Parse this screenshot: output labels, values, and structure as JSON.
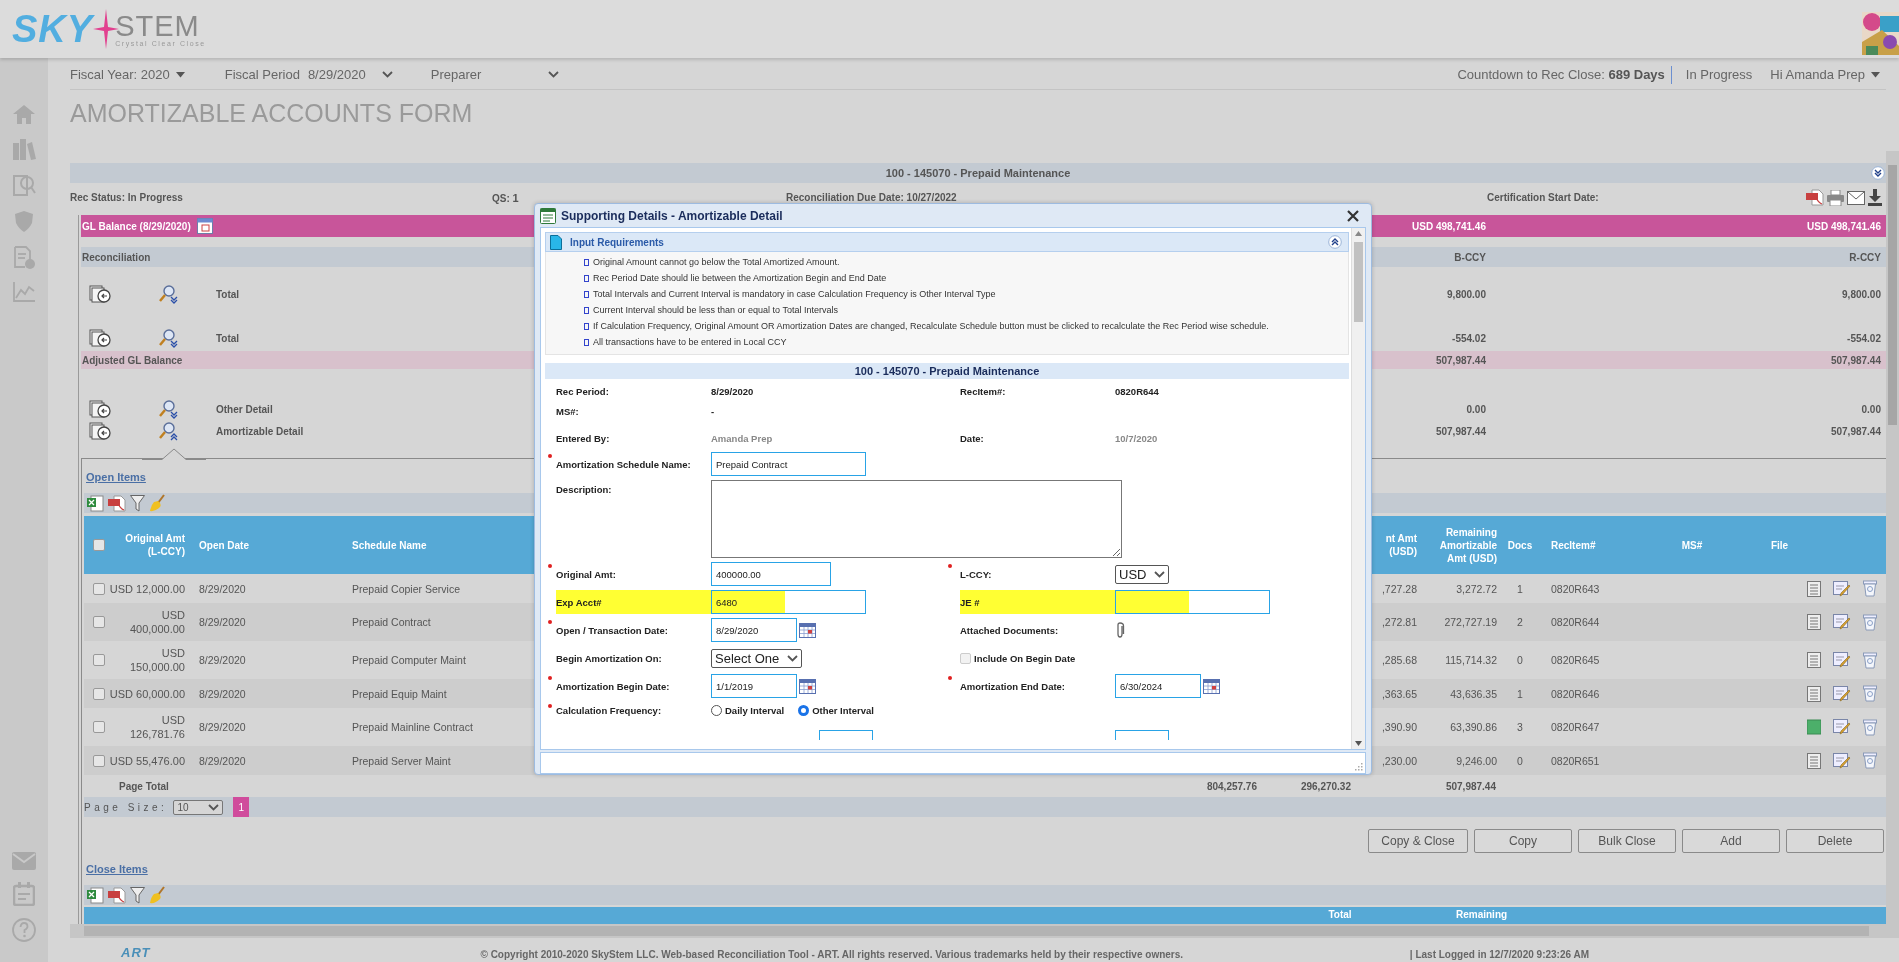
{
  "logo": {
    "brand_first": "SKY",
    "brand_second": "STEM",
    "tagline": "Crystal Clear Close"
  },
  "toolbar": {
    "fiscal_year": "Fiscal Year: 2020",
    "fiscal_period_label": "Fiscal Period",
    "fiscal_period": "8/29/2020",
    "role": "Preparer",
    "countdown": "Countdown to Rec Close: **689 Days**",
    "status": "In Progress",
    "greeting": "Hi Amanda Prep"
  },
  "page_title": "AMORTIZABLE ACCOUNTS FORM",
  "account_band": "100 - 145070 - Prepaid Maintenance",
  "info": {
    "rec_status": "Rec Status: In Progress",
    "qs_label": "QS:",
    "qs_value": "1",
    "due_date": "Reconciliation Due Date: 10/27/2022",
    "certification": "Certification Start Date:"
  },
  "gl_balance": {
    "label": "GL Balance (8/29/2020)",
    "b_ccy": "USD 498,741.46",
    "r_ccy": "USD 498,741.46"
  },
  "reconciliation": {
    "title": "Reconciliation",
    "b_ccy_header": "B-CCY",
    "r_ccy_header": "R-CCY",
    "rows": [
      {
        "kind": "line",
        "label": "Total",
        "b_ccy": "9,800.00",
        "r_ccy": "9,800.00",
        "expanded": false
      },
      {
        "kind": "line",
        "label": "Total",
        "b_ccy": "-554.02",
        "r_ccy": "-554.02",
        "expanded": false
      },
      {
        "kind": "subtotal",
        "label": "Adjusted GL Balance",
        "b_ccy": "507,987.44",
        "r_ccy": "507,987.44"
      },
      {
        "kind": "line",
        "label": "Other Detail",
        "b_ccy": "0.00",
        "r_ccy": "0.00",
        "expanded": false
      },
      {
        "kind": "line",
        "label": "Amortizable Detail",
        "b_ccy": "507,987.44",
        "r_ccy": "507,987.44",
        "expanded": true
      }
    ]
  },
  "open_items": {
    "title": "Open Items",
    "select_all": false,
    "columns": [
      "Original Amt (L-CCY)",
      "Open Date",
      "Schedule Name",
      "nt Amt (USD)",
      "Remaining Amortizable Amt (USD)",
      "Docs",
      "RecItem#",
      "MS#",
      "File"
    ],
    "rows": [
      {
        "selected": false,
        "original_amt": "USD 12,000.00",
        "open_date": "8/29/2020",
        "schedule_name": "Prepaid Copier Service",
        "amt_usd": ",727.28",
        "remaining": "3,272.72",
        "docs": "1",
        "rec_item": "0820R643",
        "attached": false
      },
      {
        "selected": false,
        "original_amt": "USD 400,000.00",
        "open_date": "8/29/2020",
        "schedule_name": "Prepaid Contract",
        "amt_usd": ",272.81",
        "remaining": "272,727.19",
        "docs": "2",
        "rec_item": "0820R644",
        "attached": false
      },
      {
        "selected": false,
        "original_amt": "USD 150,000.00",
        "open_date": "8/29/2020",
        "schedule_name": "Prepaid Computer Maint",
        "amt_usd": ",285.68",
        "remaining": "115,714.32",
        "docs": "0",
        "rec_item": "0820R645",
        "attached": false
      },
      {
        "selected": false,
        "original_amt": "USD 60,000.00",
        "open_date": "8/29/2020",
        "schedule_name": "Prepaid Equip Maint",
        "amt_usd": ",363.65",
        "remaining": "43,636.35",
        "docs": "1",
        "rec_item": "0820R646",
        "attached": false
      },
      {
        "selected": false,
        "original_amt": "USD 126,781.76",
        "open_date": "8/29/2020",
        "schedule_name": "Prepaid Mainline Contract",
        "amt_usd": ",390.90",
        "remaining": "63,390.86",
        "docs": "3",
        "rec_item": "0820R647",
        "attached": true
      },
      {
        "selected": false,
        "original_amt": "USD 55,476.00",
        "open_date": "8/29/2020",
        "schedule_name": "Prepaid Server Maint",
        "amt_usd": ",230.00",
        "remaining": "9,246.00",
        "docs": "0",
        "rec_item": "0820R651",
        "attached": false
      }
    ],
    "page_total_label": "Page Total",
    "totals": [
      "804,257.76",
      "296,270.32",
      "507,987.44"
    ],
    "page_size_label": "Page Size:",
    "page_size": "10",
    "pages": [
      {
        "label": "1",
        "selected": true
      }
    ]
  },
  "buttons": [
    "Copy & Close",
    "Copy",
    "Bulk Close",
    "Add",
    "Delete"
  ],
  "close_items": {
    "title": "Close Items",
    "columns": [
      "Total",
      "Remaining"
    ]
  },
  "modal": {
    "title": "Supporting Details - Amortizable Detail",
    "requirements_title": "Input Requirements",
    "requirements": [
      "Original Amount cannot go below the Total Amortized Amount.",
      "Rec Period Date should lie between the Amortization Begin and End Date",
      "Total Intervals and Current Interval is mandatory in case Calculation Frequency is Other Interval Type",
      "Current Interval should be less than or equal to Total Intervals",
      "If Calculation Frequency, Original Amount OR Amortization Dates are changed, Recalculate Schedule button must be clicked to recalculate the Rec Period wise schedule.",
      "All transactions have to be entered in Local CCY"
    ],
    "section_title": "100 - 145070 - Prepaid Maintenance",
    "rows": [
      {
        "left": {
          "kind": "static",
          "label": "Rec Period:",
          "value": "8/29/2020",
          "muted": false
        },
        "right": {
          "kind": "static",
          "label": "RecItem#:",
          "value": "0820R644",
          "muted": false
        }
      },
      {
        "left": {
          "kind": "static",
          "label": "MS#:",
          "value": "-",
          "muted": false
        }
      },
      {
        "left": {
          "kind": "static",
          "label": "Entered By:",
          "value": "Amanda Prep",
          "muted": true
        },
        "right": {
          "kind": "static",
          "label": "Date:",
          "value": "10/7/2020",
          "muted": true
        }
      },
      {
        "left": {
          "kind": "text",
          "label": "Amortization Schedule Name:",
          "value": "Prepaid Contract",
          "required": true
        }
      },
      {
        "left": {
          "kind": "textarea",
          "label": "Description:",
          "required": false
        }
      },
      {
        "left": {
          "kind": "number",
          "label": "Original Amt:",
          "value": "400000.00",
          "required": true
        },
        "right": {
          "kind": "select",
          "label": "L-CCY:",
          "value": "USD",
          "required": true
        }
      },
      {
        "left": {
          "kind": "text",
          "label": "Exp Acct#",
          "value": "6480",
          "required": false,
          "highlighted": true
        },
        "right": {
          "kind": "text",
          "label": "JE #",
          "required": false,
          "highlighted": true
        }
      },
      {
        "left": {
          "kind": "date",
          "label": "Open / Transaction Date:",
          "value": "8/29/2020",
          "required": true
        },
        "right": {
          "kind": "attachment",
          "label": "Attached Documents:",
          "required": false
        }
      },
      {
        "left": {
          "kind": "select",
          "label": "Begin Amortization On:",
          "value": "Select One",
          "required": false
        },
        "right": {
          "kind": "checkbox",
          "label": "Include On Begin Date",
          "checked": false,
          "disabled": true
        }
      },
      {
        "left": {
          "kind": "date",
          "label": "Amortization Begin Date:",
          "value": "1/1/2019",
          "required": true
        },
        "right": {
          "kind": "date",
          "label": "Amortization End Date:",
          "value": "6/30/2024",
          "required": true
        }
      },
      {
        "left": {
          "kind": "radio",
          "label": "Calculation Frequency:",
          "required": true,
          "options": [
            {
              "label": "Daily Interval",
              "selected": false
            },
            {
              "label": "Other Interval",
              "selected": true
            }
          ]
        }
      },
      {
        "left": {
          "kind": "stub"
        },
        "right": {
          "kind": "stub"
        }
      }
    ]
  },
  "footer": {
    "logo": "ART",
    "copyright": "© Copyright 2010-2020 SkyStem LLC. Web-based Reconciliation Tool - ART. All rights reserved. Various trademarks held by their respective owners.",
    "last_logged": "| Last Logged in 12/7/2020 9:23:26 AM"
  }
}
